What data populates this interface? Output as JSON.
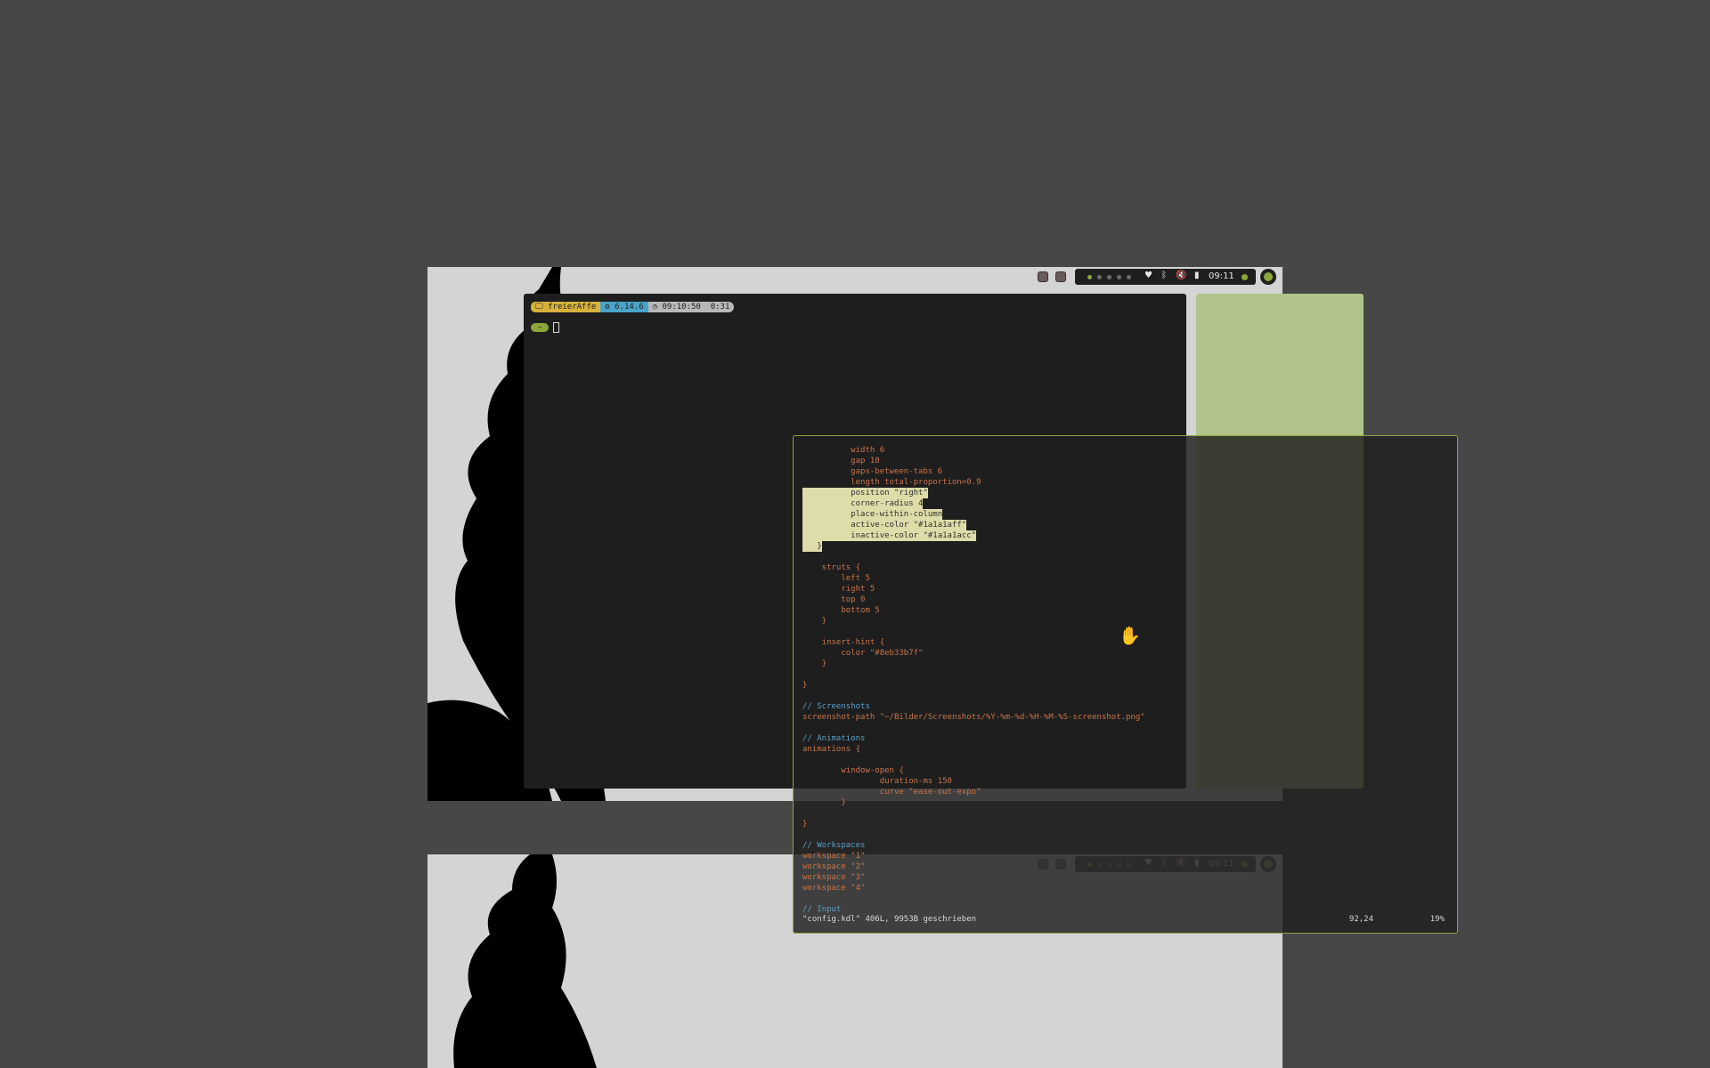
{
  "statusbar": {
    "clock": "09:11",
    "active_workspace": 1,
    "workspace_count": 5,
    "icons": [
      "wifi-icon",
      "bluetooth-icon",
      "volume-muted-icon",
      "battery-icon"
    ]
  },
  "terminal": {
    "host": "freierAffe",
    "kernel": "6.14.6",
    "time": "09:10:50",
    "duration": "0:31",
    "cwd": "~"
  },
  "editor": {
    "lines": [
      {
        "text": "          width 6",
        "style": "key"
      },
      {
        "text": "          gap 10",
        "style": "key"
      },
      {
        "text": "          gaps-between-tabs 6",
        "style": "key"
      },
      {
        "text": "          length total-proportion=0.9",
        "style": "key"
      },
      {
        "text": "          position \"right\"",
        "style": "sel"
      },
      {
        "text": "          corner-radius 4",
        "style": "sel"
      },
      {
        "text": "          place-within-column",
        "style": "sel"
      },
      {
        "text": "          active-color \"#1a1a1aff\"",
        "style": "sel"
      },
      {
        "text": "          inactive-color \"#1a1a1acc\"",
        "style": "sel"
      },
      {
        "text": "   }",
        "style": "sel"
      },
      {
        "text": "",
        "style": "plain"
      },
      {
        "text": "    struts {",
        "style": "key"
      },
      {
        "text": "        left 5",
        "style": "key"
      },
      {
        "text": "        right 5",
        "style": "key"
      },
      {
        "text": "        top 0",
        "style": "key"
      },
      {
        "text": "        bottom 5",
        "style": "key"
      },
      {
        "text": "    }",
        "style": "key"
      },
      {
        "text": "",
        "style": "plain"
      },
      {
        "text": "    insert-hint {",
        "style": "key"
      },
      {
        "text": "        color \"#8eb33b7f\"",
        "style": "key"
      },
      {
        "text": "    }",
        "style": "key"
      },
      {
        "text": "",
        "style": "plain"
      },
      {
        "text": "}",
        "style": "key"
      },
      {
        "text": "",
        "style": "plain"
      },
      {
        "text": "// Screenshots",
        "style": "comment"
      },
      {
        "text": "screenshot-path \"~/Bilder/Screenshots/%Y-%m-%d-%H-%M-%S-screenshot.png\"",
        "style": "key"
      },
      {
        "text": "",
        "style": "plain"
      },
      {
        "text": "// Animations",
        "style": "comment"
      },
      {
        "text": "animations {",
        "style": "key"
      },
      {
        "text": "",
        "style": "plain"
      },
      {
        "text": "        window-open {",
        "style": "key"
      },
      {
        "text": "                duration-ms 150",
        "style": "key"
      },
      {
        "text": "                curve \"ease-out-expo\"",
        "style": "key"
      },
      {
        "text": "        }",
        "style": "key"
      },
      {
        "text": "",
        "style": "plain"
      },
      {
        "text": "}",
        "style": "key"
      },
      {
        "text": "",
        "style": "plain"
      },
      {
        "text": "// Workspaces",
        "style": "comment"
      },
      {
        "text": "workspace \"1\"",
        "style": "key"
      },
      {
        "text": "workspace \"2\"",
        "style": "key"
      },
      {
        "text": "workspace \"3\"",
        "style": "key"
      },
      {
        "text": "workspace \"4\"",
        "style": "key"
      },
      {
        "text": "",
        "style": "plain"
      },
      {
        "text": "// Input",
        "style": "comment"
      }
    ],
    "status_message": "\"config.kdl\" 406L, 9953B geschrieben",
    "cursor_position": "92,24",
    "scroll_percent": "19%"
  },
  "colors": {
    "background": "#474747",
    "wallpaper": "#d4d4d4",
    "accent": "#8ca63a",
    "terminal_bg": "#1e1e1e",
    "side_window": "#b1c58b"
  }
}
